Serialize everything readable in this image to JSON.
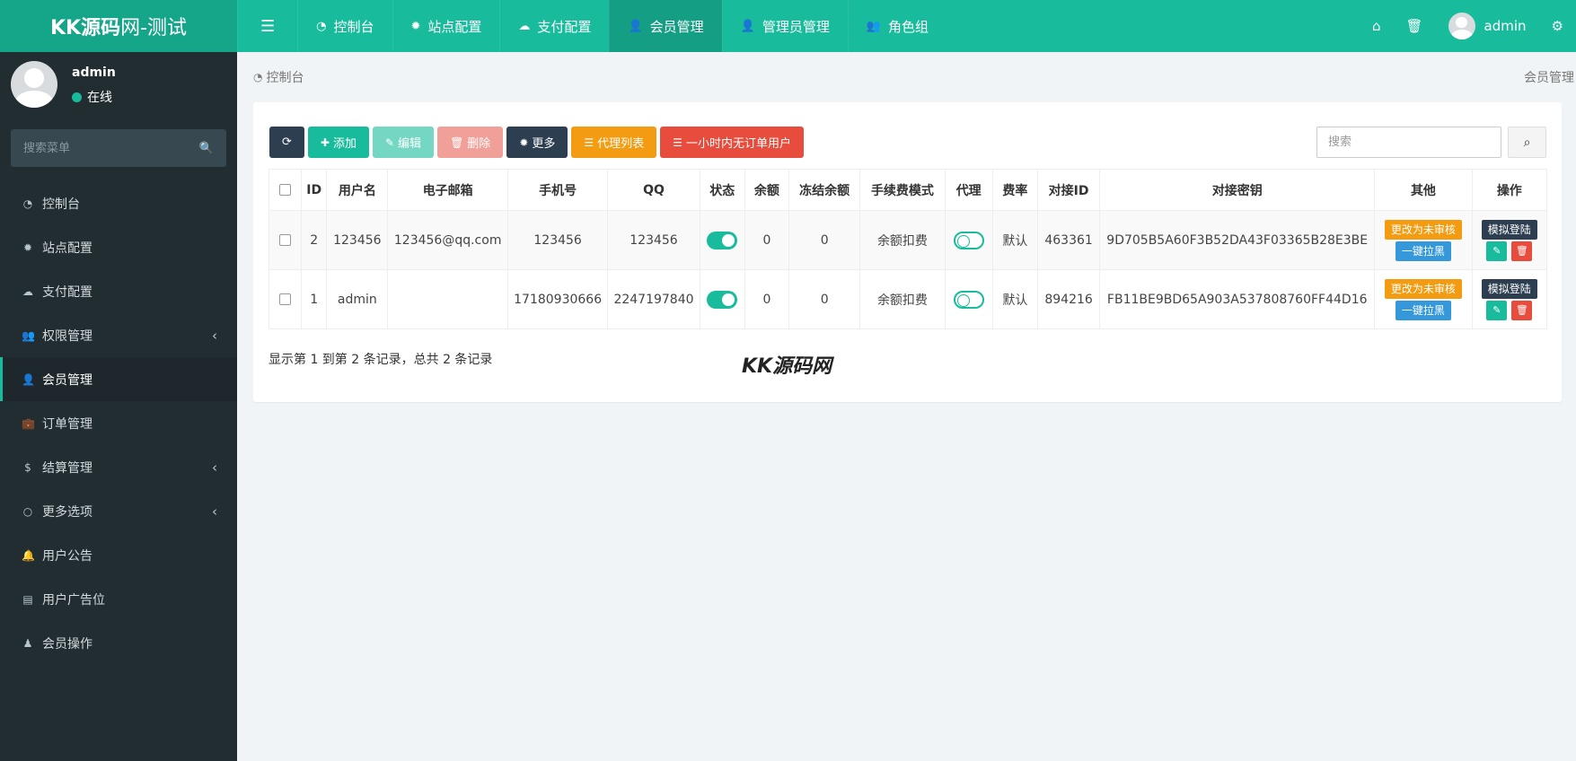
{
  "logo": {
    "brand": "KK源码",
    "suffix": "网-测试"
  },
  "topnav": {
    "toggle_icon": "menu-icon",
    "items": [
      {
        "label": "控制台",
        "icon": "dashboard-icon"
      },
      {
        "label": "站点配置",
        "icon": "gear-icon"
      },
      {
        "label": "支付配置",
        "icon": "cloud-icon"
      },
      {
        "label": "会员管理",
        "icon": "user-icon",
        "active": true
      },
      {
        "label": "管理员管理",
        "icon": "user-icon"
      },
      {
        "label": "角色组",
        "icon": "users-icon"
      }
    ],
    "user": "admin"
  },
  "sidebar": {
    "user": {
      "name": "admin",
      "status": "在线"
    },
    "search_placeholder": "搜索菜单",
    "items": [
      {
        "label": "控制台",
        "icon": "dashboard-icon"
      },
      {
        "label": "站点配置",
        "icon": "gear-icon"
      },
      {
        "label": "支付配置",
        "icon": "cloud-icon"
      },
      {
        "label": "权限管理",
        "icon": "users-icon",
        "submenu": true
      },
      {
        "label": "会员管理",
        "icon": "user-icon",
        "active": true
      },
      {
        "label": "订单管理",
        "icon": "briefcase-icon"
      },
      {
        "label": "结算管理",
        "icon": "dollar-icon",
        "submenu": true
      },
      {
        "label": "更多选项",
        "icon": "circle-icon",
        "submenu": true
      },
      {
        "label": "用户公告",
        "icon": "bell-icon"
      },
      {
        "label": "用户广告位",
        "icon": "archive-icon"
      },
      {
        "label": "会员操作",
        "icon": "user-tie-icon"
      }
    ]
  },
  "breadcrumb": {
    "left": "控制台",
    "right": "会员管理"
  },
  "toolbar": {
    "add": "添加",
    "edit": "编辑",
    "delete": "删除",
    "more": "更多",
    "agent_list": "代理列表",
    "no_order_users": "一小时内无订单用户",
    "search_placeholder": "搜索"
  },
  "table": {
    "headers": [
      "ID",
      "用户名",
      "电子邮箱",
      "手机号",
      "QQ",
      "状态",
      "余额",
      "冻结余额",
      "手续费模式",
      "代理",
      "费率",
      "对接ID",
      "对接密钥",
      "其他",
      "操作"
    ],
    "rows": [
      {
        "id": "2",
        "username": "123456",
        "email": "123456@qq.com",
        "phone": "123456",
        "qq": "123456",
        "status": true,
        "balance": "0",
        "frozen": "0",
        "fee_mode": "余额扣费",
        "agent": false,
        "rate": "默认",
        "api_id": "463361",
        "api_key": "9D705B5A60F3B52DA43F03365B28E3BE"
      },
      {
        "id": "1",
        "username": "admin",
        "email": "",
        "phone": "17180930666",
        "qq": "2247197840",
        "status": true,
        "balance": "0",
        "frozen": "0",
        "fee_mode": "余额扣费",
        "agent": false,
        "rate": "默认",
        "api_id": "894216",
        "api_key": "FB11BE9BD65A903A537808760FF44D16"
      }
    ],
    "other_btn1": "更改为未审核",
    "other_btn2": "一键拉黑",
    "op_btn": "模拟登陆"
  },
  "pagination": {
    "info": "显示第 1 到第 2 条记录，总共 2 条记录"
  },
  "watermark": "KK源码网",
  "colors": {
    "primary": "#18bc9c",
    "sidebar": "#222d32",
    "warning": "#f39c12",
    "danger": "#e74c3c",
    "info": "#3498db",
    "dark": "#2c3e50"
  }
}
